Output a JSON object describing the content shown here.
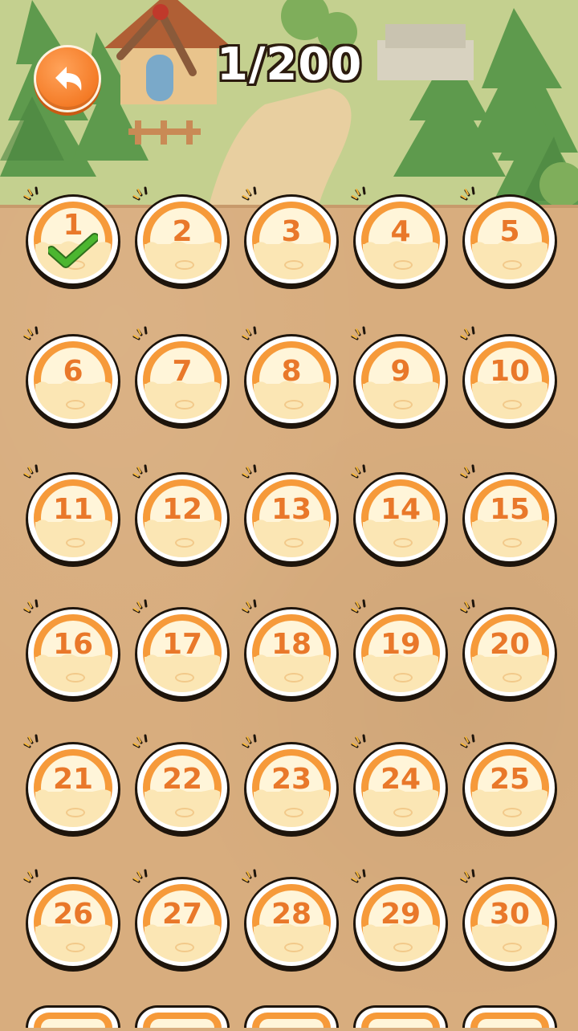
{
  "header": {
    "progress": "1/200",
    "back_icon": "undo-arrow-icon"
  },
  "levels": [
    {
      "label": "1",
      "completed": true
    },
    {
      "label": "2",
      "completed": false
    },
    {
      "label": "3",
      "completed": false
    },
    {
      "label": "4",
      "completed": false
    },
    {
      "label": "5",
      "completed": false
    },
    {
      "label": "6",
      "completed": false
    },
    {
      "label": "7",
      "completed": false
    },
    {
      "label": "8",
      "completed": false
    },
    {
      "label": "9",
      "completed": false
    },
    {
      "label": "10",
      "completed": false
    },
    {
      "label": "11",
      "completed": false
    },
    {
      "label": "12",
      "completed": false
    },
    {
      "label": "13",
      "completed": false
    },
    {
      "label": "14",
      "completed": false
    },
    {
      "label": "15",
      "completed": false
    },
    {
      "label": "16",
      "completed": false
    },
    {
      "label": "17",
      "completed": false
    },
    {
      "label": "18",
      "completed": false
    },
    {
      "label": "19",
      "completed": false
    },
    {
      "label": "20",
      "completed": false
    },
    {
      "label": "21",
      "completed": false
    },
    {
      "label": "22",
      "completed": false
    },
    {
      "label": "23",
      "completed": false
    },
    {
      "label": "24",
      "completed": false
    },
    {
      "label": "25",
      "completed": false
    },
    {
      "label": "26",
      "completed": false
    },
    {
      "label": "27",
      "completed": false
    },
    {
      "label": "28",
      "completed": false
    },
    {
      "label": "29",
      "completed": false
    },
    {
      "label": "30",
      "completed": false
    }
  ],
  "colors": {
    "accent": "#f69a3a",
    "number": "#e9782a",
    "check": "#4cb630",
    "board": "#d8ad7e"
  }
}
